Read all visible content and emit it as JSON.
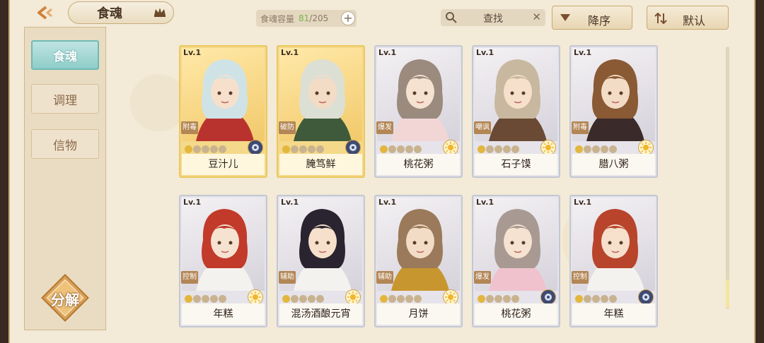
{
  "header": {
    "title": "食魂",
    "capacity_label": "食魂容量",
    "capacity_current": "81",
    "capacity_total": "/205",
    "capacity_plus": "+",
    "search_label": "查找",
    "search_clear": "✕",
    "sort_desc_label": "降序",
    "sort_default_label": "默认"
  },
  "sidebar": {
    "items": [
      {
        "label": "食魂",
        "active": true
      },
      {
        "label": "调理",
        "active": false
      },
      {
        "label": "信物",
        "active": false
      }
    ],
    "decompose_label": "分解"
  },
  "cards": [
    {
      "lv": "Lv.1",
      "name": "豆汁儿",
      "type": "附毒",
      "rarity": "gold",
      "stars": 0,
      "element": "night"
    },
    {
      "lv": "Lv.1",
      "name": "腌笃鲜",
      "type": "破防",
      "rarity": "gold",
      "stars": 0,
      "element": "night"
    },
    {
      "lv": "Lv.1",
      "name": "桃花粥",
      "type": "爆发",
      "rarity": "silver",
      "stars": 0,
      "element": "sun"
    },
    {
      "lv": "Lv.1",
      "name": "石子馍",
      "type": "嘲讽",
      "rarity": "silver",
      "stars": 0,
      "element": "sun"
    },
    {
      "lv": "Lv.1",
      "name": "腊八粥",
      "type": "附毒",
      "rarity": "silver",
      "stars": 0,
      "element": "sun"
    },
    {
      "lv": "Lv.1",
      "name": "年糕",
      "type": "控制",
      "rarity": "silver",
      "stars": 0,
      "element": "sun"
    },
    {
      "lv": "Lv.1",
      "name": "混汤酒酿元宵",
      "type": "辅助",
      "rarity": "silver",
      "stars": 0,
      "element": "sun"
    },
    {
      "lv": "Lv.1",
      "name": "月饼",
      "type": "辅助",
      "rarity": "silver",
      "stars": 0,
      "element": "sun"
    },
    {
      "lv": "Lv.1",
      "name": "桃花粥",
      "type": "爆发",
      "rarity": "silver",
      "stars": 0,
      "element": "night"
    },
    {
      "lv": "Lv.1",
      "name": "年糕",
      "type": "控制",
      "rarity": "silver",
      "stars": 0,
      "element": "night"
    }
  ],
  "colors": {
    "frame_bg": "#f3ead7",
    "active_tab": "#8fcdc9",
    "gold_card": "#f4d98a",
    "silver_card": "#e6e3ea",
    "capacity_current": "#7bb34a"
  }
}
